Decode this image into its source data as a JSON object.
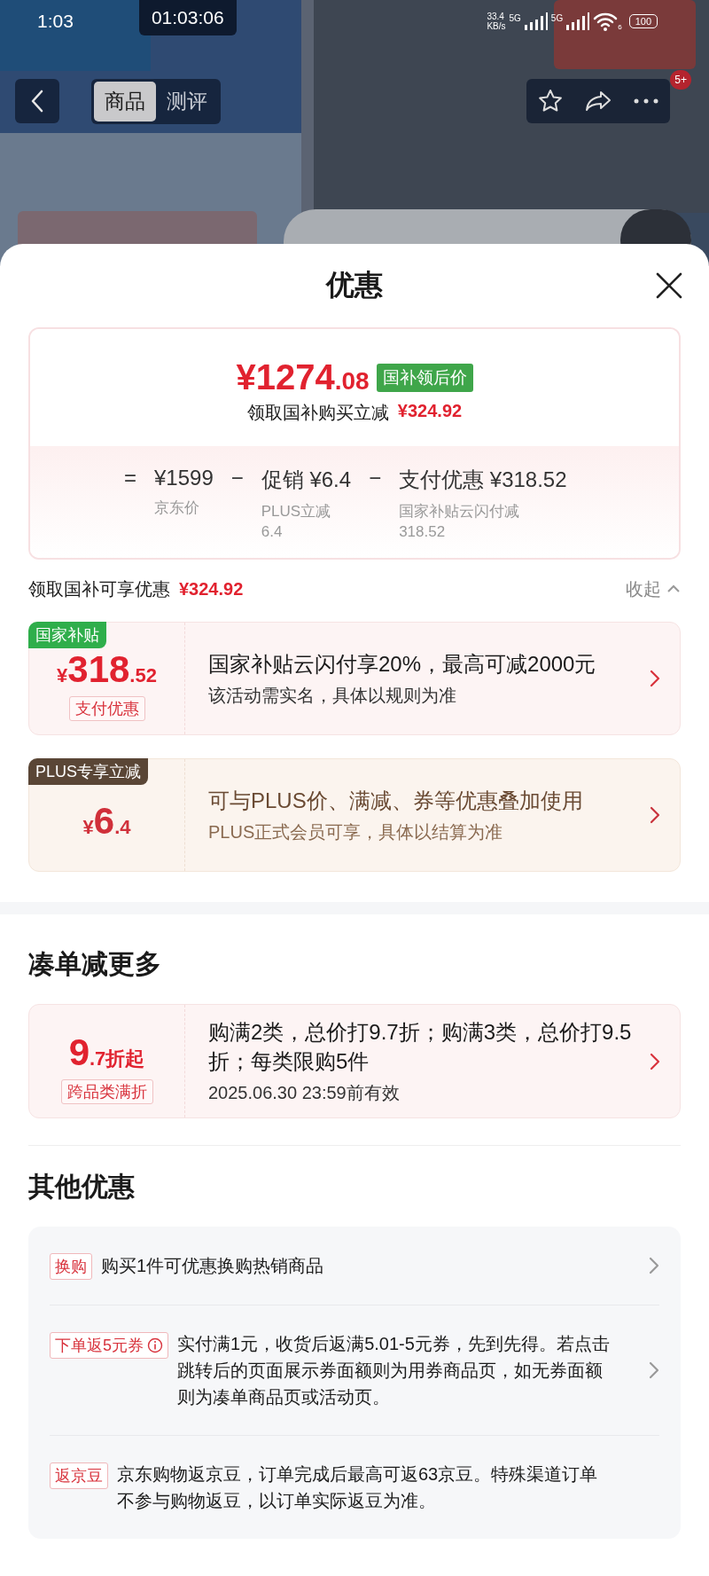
{
  "status_bar": {
    "time": "1:03",
    "recording_timer": "01:03:06",
    "net_speed": "33.4",
    "net_speed_unit": "KB/s",
    "networks": [
      "5G",
      "5G"
    ],
    "wifi_number": "6",
    "battery": "100"
  },
  "nav": {
    "tabs": [
      {
        "label": "商品",
        "selected": true
      },
      {
        "label": "测评",
        "selected": false
      }
    ],
    "badge": "5+"
  },
  "sheet": {
    "title": "优惠",
    "price_card": {
      "price_int": "¥1274",
      "price_dec": ".08",
      "price_tag": "国补领后价",
      "subtitle": "领取国补购买立减",
      "subtitle_amount": "¥324.92",
      "breakdown": [
        {
          "operator": "=",
          "value": "¥1599",
          "note": [
            "京东价"
          ]
        },
        {
          "operator": "−",
          "label": "促销",
          "value": "¥6.4",
          "note": [
            "PLUS立减",
            "6.4"
          ]
        },
        {
          "operator": "−",
          "label": "支付优惠",
          "value": "¥318.52",
          "note": [
            "国家补贴云闪付减",
            "318.52"
          ]
        }
      ]
    },
    "summary": {
      "label": "领取国补可享优惠",
      "amount": "¥324.92",
      "toggle": "收起",
      "expanded": true
    },
    "coupons": [
      {
        "kind": "subsidy",
        "corner_tag": "国家补贴",
        "currency": "¥",
        "amount_int": "318",
        "amount_dec": ".52",
        "type_tag": "支付优惠",
        "title": "国家补贴云闪付享20%，最高可减2000元",
        "desc": "该活动需实名，具体以规则为准"
      },
      {
        "kind": "plus",
        "corner_tag": "PLUS专享立减",
        "currency": "¥",
        "amount_int": "6",
        "amount_dec": ".4",
        "title": "可与PLUS价、满减、券等优惠叠加使用",
        "desc": "PLUS正式会员可享，具体以结算为准"
      }
    ],
    "bundle_section": {
      "title": "凑单减更多",
      "coupons": [
        {
          "kind": "bundle",
          "amount_int": "9",
          "amount_dec": ".7折起",
          "type_tag": "跨品类满折",
          "title": "购满2类，总价打9.7折；购满3类，总价打9.5折；每类限购5件",
          "desc": "2025.06.30 23:59前有效"
        }
      ]
    },
    "other_section": {
      "title": "其他优惠",
      "items": [
        {
          "tag": "换购",
          "info": false,
          "arrow": true,
          "text": "购买1件可优惠换购热销商品"
        },
        {
          "tag": "下单返5元券",
          "info": true,
          "arrow": true,
          "text": "实付满1元，收货后返满5.01-5元券，先到先得。若点击跳转后的页面展示券面额则为用券商品页，如无券面额则为凑单商品页或活动页。"
        },
        {
          "tag": "返京豆",
          "info": false,
          "arrow": false,
          "text": "京东购物返京豆，订单完成后最高可返63京豆。特殊渠道订单不参与购物返豆，以订单实际返豆为准。"
        }
      ]
    }
  }
}
